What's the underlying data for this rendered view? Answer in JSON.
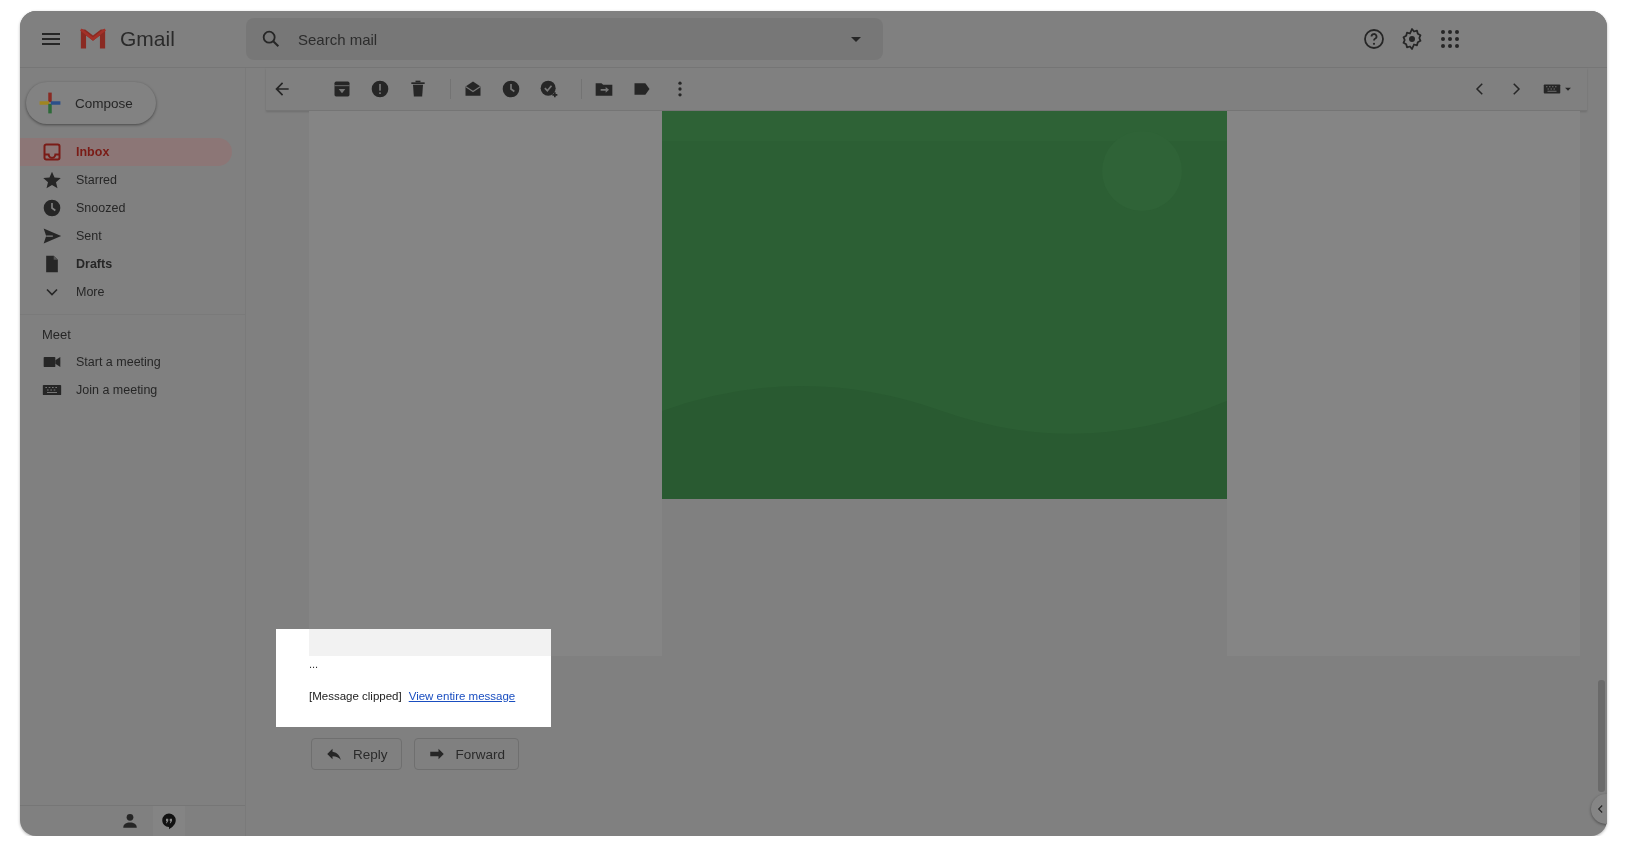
{
  "header": {
    "app_name": "Gmail",
    "search": {
      "placeholder": "Search mail"
    }
  },
  "compose": {
    "label": "Compose"
  },
  "nav": [
    {
      "label": "Inbox",
      "selected": true,
      "bold": true
    },
    {
      "label": "Starred",
      "selected": false,
      "bold": false
    },
    {
      "label": "Snoozed",
      "selected": false,
      "bold": false
    },
    {
      "label": "Sent",
      "selected": false,
      "bold": false
    },
    {
      "label": "Drafts",
      "selected": false,
      "bold": true
    },
    {
      "label": "More",
      "selected": false,
      "bold": false
    }
  ],
  "meet": {
    "title": "Meet",
    "items": [
      {
        "label": "Start a meeting"
      },
      {
        "label": "Join a meeting"
      }
    ]
  },
  "message": {
    "ellipsis": "...",
    "clipped_note": "[Message clipped]",
    "link": "View entire message"
  },
  "actions": [
    {
      "kind": "reply",
      "label": "Reply"
    },
    {
      "kind": "forward",
      "label": "Forward"
    }
  ]
}
